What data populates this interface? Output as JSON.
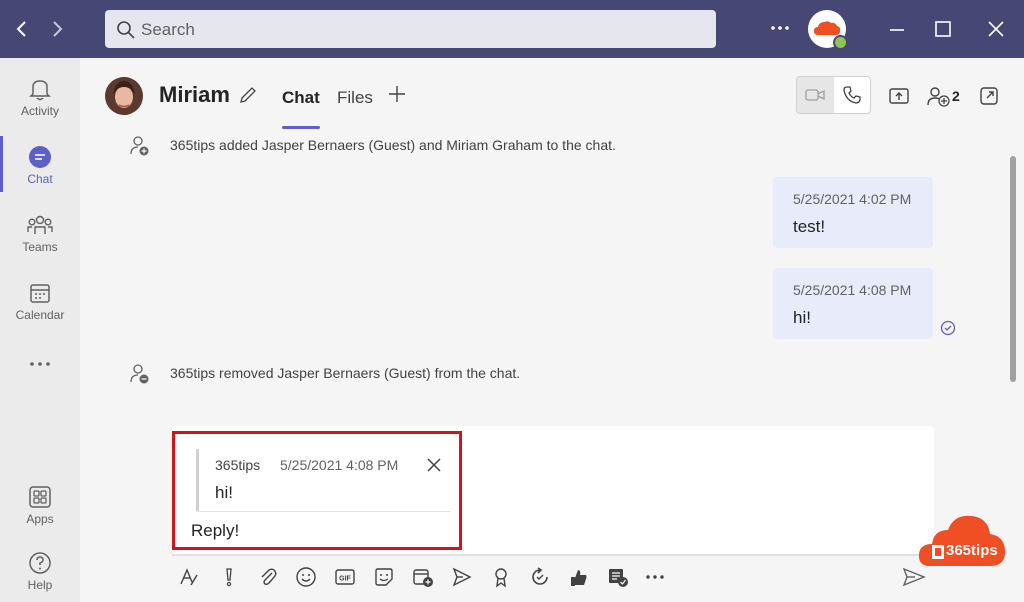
{
  "search": {
    "placeholder": "Search"
  },
  "rail": {
    "items": [
      {
        "label": "Activity"
      },
      {
        "label": "Chat"
      },
      {
        "label": "Teams"
      },
      {
        "label": "Calendar"
      },
      {
        "label": "Apps"
      },
      {
        "label": "Help"
      }
    ]
  },
  "header": {
    "name": "Miriam",
    "tabs": [
      {
        "label": "Chat"
      },
      {
        "label": "Files"
      }
    ],
    "participant_count": "2"
  },
  "messages": {
    "system_added": "365tips added Jasper Bernaers (Guest) and Miriam Graham to the chat.",
    "msg1_time": "5/25/2021 4:02 PM",
    "msg1_text": "test!",
    "msg2_time": "5/25/2021 4:08 PM",
    "msg2_text": "hi!",
    "system_removed": "365tips removed Jasper Bernaers (Guest) from the chat."
  },
  "compose": {
    "quote_author": "365tips",
    "quote_time": "5/25/2021 4:08 PM",
    "quote_text": "hi!",
    "reply_text": "Reply!"
  },
  "watermark": {
    "text": "365tips"
  },
  "colors": {
    "titlebar": "#464775",
    "accent": "#5b5fc7",
    "bubble": "#e8ebfa",
    "highlight": "#d0131f",
    "presence": "#92c353",
    "brand_orange": "#f04e23"
  },
  "icons": [
    "back-icon",
    "forward-icon",
    "search-icon",
    "more-icon",
    "minimize-icon",
    "maximize-icon",
    "close-icon",
    "bell-icon",
    "chat-icon",
    "teams-icon",
    "calendar-icon",
    "ellipsis-icon",
    "apps-icon",
    "help-icon",
    "pencil-icon",
    "plus-icon",
    "video-icon",
    "phone-icon",
    "share-screen-icon",
    "people-add-icon",
    "pop-out-icon",
    "person-add-icon",
    "person-remove-icon",
    "read-receipt-icon",
    "format-icon",
    "important-icon",
    "attach-icon",
    "emoji-icon",
    "gif-icon",
    "sticker-icon",
    "meet-now-icon",
    "stream-icon",
    "praise-icon",
    "loop-icon",
    "approvals-icon",
    "forms-icon",
    "send-icon"
  ]
}
